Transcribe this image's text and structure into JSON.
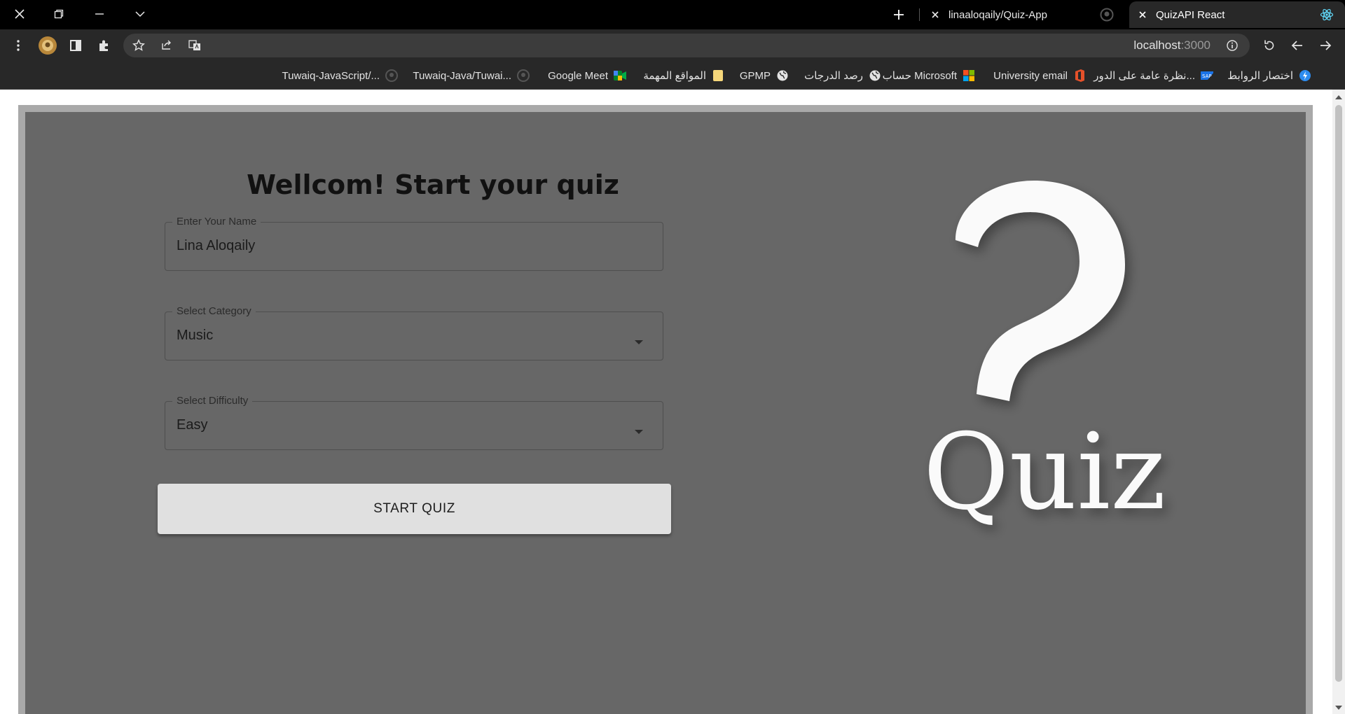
{
  "browser": {
    "tabs": [
      {
        "title": "linaaloqaily/Quiz-App",
        "favicon": "github-icon",
        "active": false
      },
      {
        "title": "QuizAPI React",
        "favicon": "react-icon",
        "active": true
      }
    ],
    "address": {
      "host": "localhost",
      "port": ":3000"
    },
    "bookmarks": [
      {
        "label": "اختصار الروابط",
        "icon": "link-shortener-icon"
      },
      {
        "label": "نظرة عامة على الدور...",
        "icon": "sap-icon"
      },
      {
        "label": "University email",
        "icon": "office-icon"
      },
      {
        "label": "حساب Microsoft",
        "icon": "microsoft-icon"
      },
      {
        "label": "رصد الدرجات",
        "icon": "globe-icon"
      },
      {
        "label": "GPMP",
        "icon": "globe-icon"
      },
      {
        "label": "المواقع المهمة",
        "icon": "folder-icon"
      },
      {
        "label": "Google Meet",
        "icon": "google-meet-icon"
      },
      {
        "label": "Tuwaiq-Java/Tuwai...",
        "icon": "github-icon"
      },
      {
        "label": "Tuwaiq-JavaScript/...",
        "icon": "github-icon"
      }
    ]
  },
  "quiz": {
    "heading": "Wellcom! Start your quiz",
    "name_field": {
      "label": "Enter Your Name",
      "value": "Lina Aloqaily"
    },
    "category_field": {
      "label": "Select Category",
      "value": "Music"
    },
    "difficulty_field": {
      "label": "Select Difficulty",
      "value": "Easy"
    },
    "start_button": "START QUIZ",
    "logo_text": "Quiz"
  },
  "colors": {
    "app_background": "#676767",
    "frame": "#a9a9a9",
    "button": "#e0e0e0"
  }
}
